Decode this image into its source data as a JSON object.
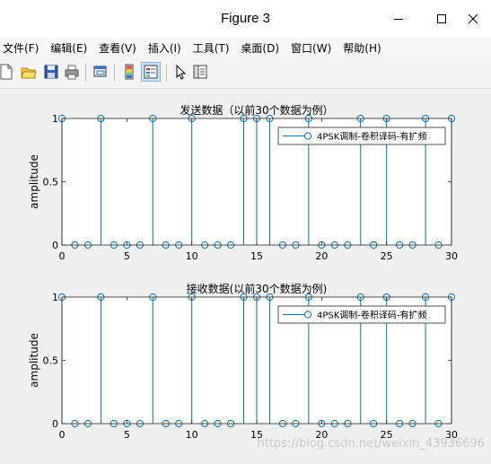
{
  "window": {
    "title": "Figure 3"
  },
  "menu": {
    "items": [
      "文件(F)",
      "编辑(E)",
      "查看(V)",
      "插入(I)",
      "工具(T)",
      "桌面(D)",
      "窗口(W)",
      "帮助(H)"
    ]
  },
  "toolbar": {
    "icons": [
      "new-figure-icon",
      "open-file-icon",
      "save-icon",
      "print-icon",
      "link-plot-icon",
      "insert-colorbar-icon",
      "insert-legend-icon",
      "pointer-icon",
      "property-editor-icon"
    ]
  },
  "watermark": "https://blog.csdn.net/weixin_43936696",
  "chart_data": [
    {
      "type": "stem",
      "title": "发送数据（以前30个数据为例）",
      "xlabel": "",
      "ylabel": "amplitude",
      "xlim": [
        0,
        30
      ],
      "ylim": [
        0,
        1
      ],
      "xticks": [
        0,
        5,
        10,
        15,
        20,
        25,
        30
      ],
      "yticks": [
        0,
        0.5,
        1
      ],
      "legend": {
        "label": "4PSK调制-卷积译码-有扩频",
        "position": "top-right"
      },
      "series": [
        {
          "name": "4PSK调制-卷积译码-有扩频",
          "x": [
            0,
            1,
            2,
            3,
            4,
            5,
            6,
            7,
            8,
            9,
            10,
            11,
            12,
            13,
            14,
            15,
            16,
            17,
            18,
            19,
            20,
            21,
            22,
            23,
            24,
            25,
            26,
            27,
            28,
            29,
            30
          ],
          "y": [
            1,
            0,
            0,
            1,
            0,
            0,
            0,
            1,
            0,
            0,
            1,
            0,
            0,
            0,
            1,
            1,
            1,
            0,
            0,
            1,
            0,
            0,
            0,
            1,
            0,
            1,
            0,
            0,
            1,
            0,
            1
          ]
        }
      ]
    },
    {
      "type": "stem",
      "title": "接收数据(以前30个数据为例)",
      "xlabel": "",
      "ylabel": "amplitude",
      "xlim": [
        0,
        30
      ],
      "ylim": [
        0,
        1
      ],
      "xticks": [
        0,
        5,
        10,
        15,
        20,
        25,
        30
      ],
      "yticks": [
        0,
        0.5,
        1
      ],
      "legend": {
        "label": "4PSK调制-卷积译码-有扩频",
        "position": "top-right"
      },
      "series": [
        {
          "name": "4PSK调制-卷积译码-有扩频",
          "x": [
            0,
            1,
            2,
            3,
            4,
            5,
            6,
            7,
            8,
            9,
            10,
            11,
            12,
            13,
            14,
            15,
            16,
            17,
            18,
            19,
            20,
            21,
            22,
            23,
            24,
            25,
            26,
            27,
            28,
            29,
            30
          ],
          "y": [
            1,
            0,
            0,
            1,
            0,
            0,
            0,
            1,
            0,
            0,
            1,
            0,
            0,
            0,
            1,
            1,
            1,
            0,
            0,
            1,
            0,
            0,
            0,
            1,
            0,
            1,
            0,
            0,
            1,
            0,
            1
          ]
        }
      ]
    }
  ]
}
